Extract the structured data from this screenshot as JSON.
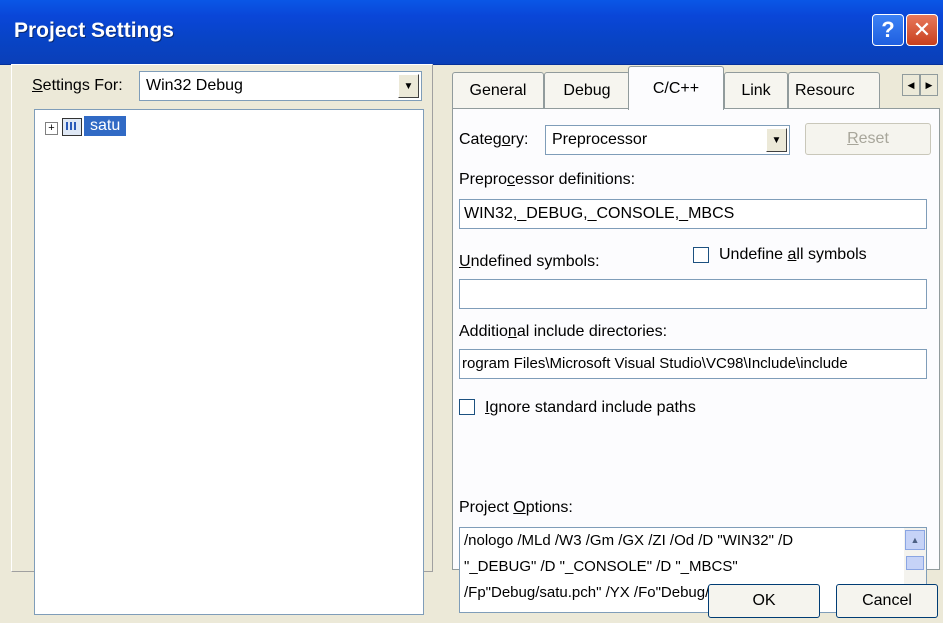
{
  "window": {
    "title": "Project Settings",
    "help_label": "?",
    "close_label": "✕"
  },
  "left": {
    "settings_for_label_accel": "S",
    "settings_for_label_rest": "ettings For:",
    "settings_for_value": "Win32 Debug",
    "tree_expander": "+",
    "tree_item": "satu"
  },
  "tabs": [
    {
      "label": "General"
    },
    {
      "label": "Debug"
    },
    {
      "label": "C/C++"
    },
    {
      "label": "Link"
    },
    {
      "label": "Resourc"
    }
  ],
  "tab_scroll": {
    "left": "◀",
    "right": "▶"
  },
  "cpp": {
    "category_pre": "Categ",
    "category_accel": "o",
    "category_post": "ry:",
    "category_value": "Preprocessor",
    "reset_accel": "R",
    "reset_rest": "eset",
    "preproc_label_pre": "Prepro",
    "preproc_label_accel": "c",
    "preproc_label_post": "essor definitions:",
    "preproc_value": "WIN32,_DEBUG,_CONSOLE,_MBCS",
    "undefined_accel": "U",
    "undefined_rest": "ndefined symbols:",
    "undefined_value": "",
    "undefine_all_pre": "Undefine ",
    "undefine_all_accel": "a",
    "undefine_all_post": "ll symbols",
    "include_label_pre": "Additio",
    "include_label_accel": "n",
    "include_label_post": "al include directories:",
    "include_value": "rogram Files\\Microsoft Visual Studio\\VC98\\Include\\include",
    "ignore_accel": "I",
    "ignore_rest": "gnore standard include paths",
    "options_label_pre": "Project ",
    "options_label_accel": "O",
    "options_label_post": "ptions:",
    "options_lines": [
      "/nologo /MLd /W3 /Gm /GX /ZI /Od /D \"WIN32\" /D",
      "\"_DEBUG\" /D \"_CONSOLE\" /D \"_MBCS\"",
      "/Fp\"Debug/satu.pch\" /YX /Fo\"Debug/\" /Fd\"Debug/\""
    ],
    "scroll_up": "▲",
    "scroll_down": "▼"
  },
  "footer": {
    "ok_label": "OK",
    "cancel_label": "Cancel"
  }
}
